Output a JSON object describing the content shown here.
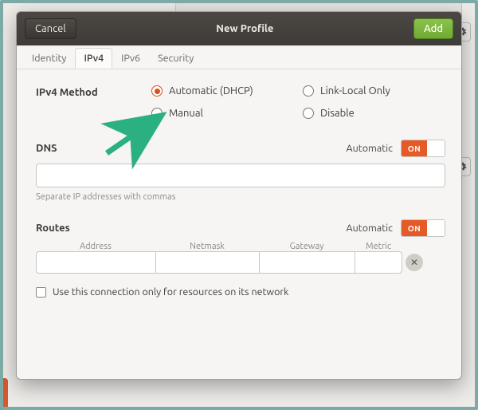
{
  "header": {
    "cancel": "Cancel",
    "title": "New Profile",
    "add": "Add"
  },
  "tabs": {
    "identity": "Identity",
    "ipv4": "IPv4",
    "ipv6": "IPv6",
    "security": "Security",
    "active": "ipv4"
  },
  "ipv4": {
    "method_label": "IPv4 Method",
    "radios": {
      "auto": "Automatic (DHCP)",
      "linklocal": "Link-Local Only",
      "manual": "Manual",
      "disable": "Disable",
      "selected": "auto"
    },
    "dns": {
      "title": "DNS",
      "auto_label": "Automatic",
      "switch": "ON",
      "value": "",
      "hint": "Separate IP addresses with commas"
    },
    "routes": {
      "title": "Routes",
      "auto_label": "Automatic",
      "switch": "ON",
      "cols": {
        "address": "Address",
        "netmask": "Netmask",
        "gateway": "Gateway",
        "metric": "Metric"
      },
      "row": {
        "address": "",
        "netmask": "",
        "gateway": "",
        "metric": ""
      },
      "only_resources": "Use this connection only for resources on its network",
      "only_resources_checked": false
    }
  },
  "colors": {
    "accent": "#e55a27",
    "add_btn": "#7cb342",
    "arrow": "#2bb081"
  }
}
